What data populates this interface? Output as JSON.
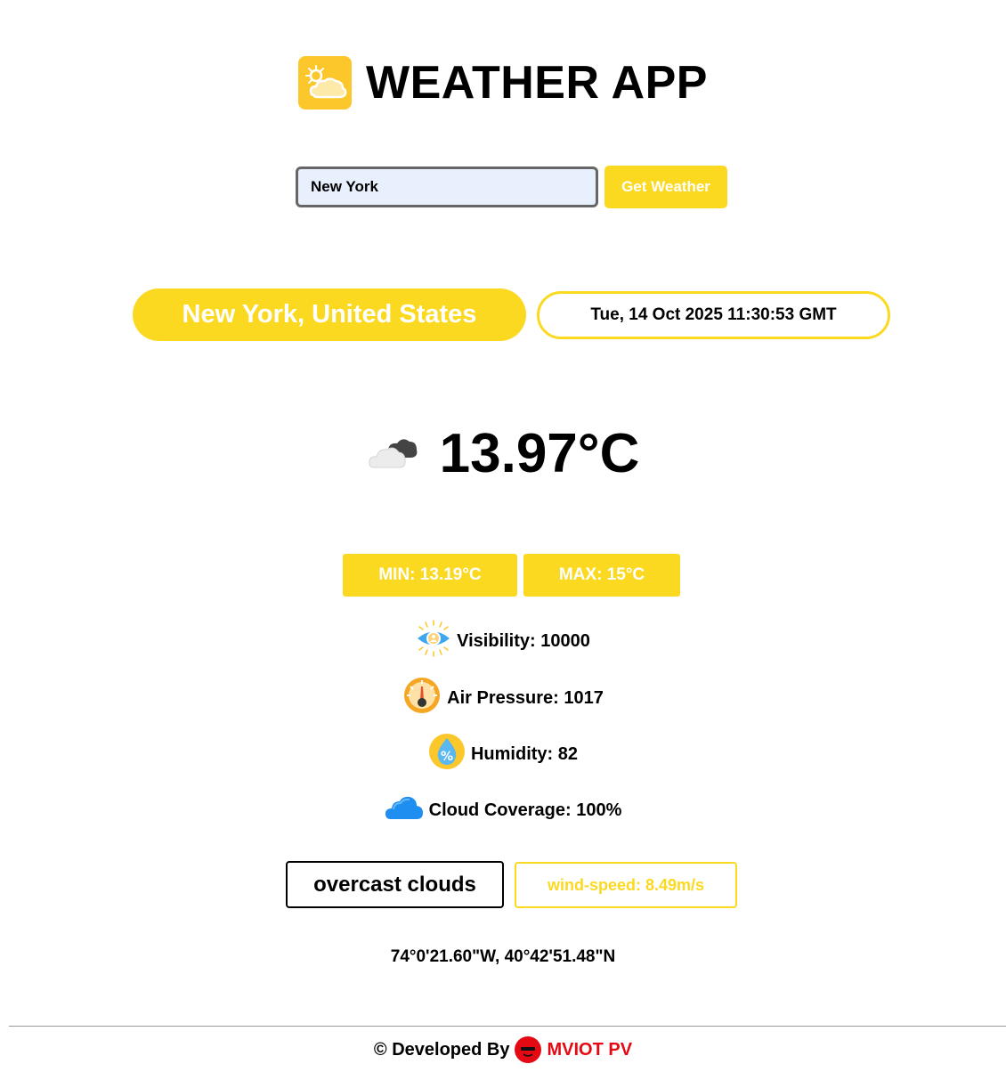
{
  "header": {
    "title": "WEATHER APP",
    "logo_icon": "sun-cloud-icon"
  },
  "search": {
    "value": "New York",
    "button_label": "Get Weather"
  },
  "location": {
    "name": "New York, United States",
    "datetime": "Tue, 14 Oct 2025 11:30:53 GMT"
  },
  "current": {
    "temperature": "13.97°C",
    "condition_icon": "broken-clouds-icon"
  },
  "range": {
    "min": "MIN: 13.19°C",
    "max": "MAX: 15°C"
  },
  "stats": {
    "visibility": "Visibility: 10000",
    "pressure": "Air Pressure: 1017",
    "humidity": "Humidity: 82",
    "clouds": "Cloud Coverage: 100%"
  },
  "description": "overcast clouds",
  "wind": "wind-speed: 8.49m/s",
  "coordinates": "74°0'21.60\"W, 40°42'51.48\"N",
  "footer": {
    "prefix": "© Developed By",
    "brand": "MVIOT PV"
  },
  "colors": {
    "accent": "#fcd921",
    "logo_bg": "#fcc72a",
    "brand": "#e50914"
  }
}
